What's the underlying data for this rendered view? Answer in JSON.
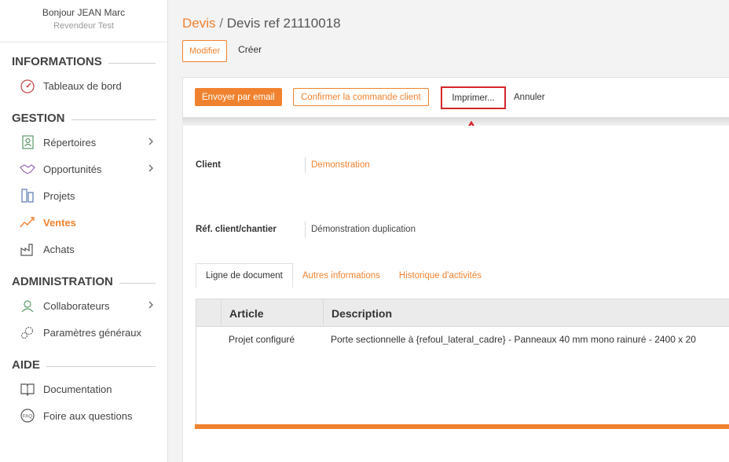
{
  "user": {
    "greeting": "Bonjour JEAN Marc",
    "role": "Revendeur Test"
  },
  "sidebar": {
    "sections": [
      {
        "title": "INFORMATIONS",
        "items": [
          {
            "label": "Tableaux de bord",
            "icon": "dashboard-icon"
          }
        ]
      },
      {
        "title": "GESTION",
        "items": [
          {
            "label": "Répertoires",
            "icon": "contacts-icon",
            "chevron": true
          },
          {
            "label": "Opportunités",
            "icon": "handshake-icon",
            "chevron": true
          },
          {
            "label": "Projets",
            "icon": "projects-icon"
          },
          {
            "label": "Ventes",
            "icon": "sales-icon",
            "active": true
          },
          {
            "label": "Achats",
            "icon": "factory-icon"
          }
        ]
      },
      {
        "title": "ADMINISTRATION",
        "items": [
          {
            "label": "Collaborateurs",
            "icon": "users-icon",
            "chevron": true
          },
          {
            "label": "Paramètres généraux",
            "icon": "gears-icon"
          }
        ]
      },
      {
        "title": "AIDE",
        "items": [
          {
            "label": "Documentation",
            "icon": "book-icon"
          },
          {
            "label": "Foire aux questions",
            "icon": "faq-icon"
          }
        ]
      }
    ]
  },
  "breadcrumb": {
    "parent": "Devis",
    "separator": "/",
    "current": "Devis ref 21110018"
  },
  "mode_tabs": {
    "modifier": "Modifier",
    "creer": "Créer"
  },
  "toolbar": {
    "email": "Envoyer par email",
    "confirm": "Confirmer la commande client",
    "print": "Imprimer...",
    "cancel": "Annuler"
  },
  "fields": {
    "client_label": "Client",
    "client_value": "Demonstration",
    "ref_label": "Réf. client/chantier",
    "ref_value": "Démonstration duplication"
  },
  "tabs": [
    "Ligne de document",
    "Autres informations",
    "Historique d'activités"
  ],
  "grid": {
    "headers": {
      "article": "Article",
      "description": "Description"
    },
    "rows": [
      {
        "article": "Projet configuré",
        "description": "Porte sectionnelle à {refoul_lateral_cadre} - Panneaux 40 mm mono rainuré - 2400 x 20"
      }
    ]
  },
  "colors": {
    "accent": "#f0822f",
    "highlight": "#d6262b"
  }
}
